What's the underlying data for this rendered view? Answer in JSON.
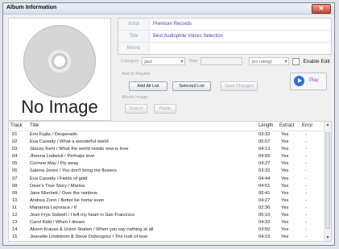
{
  "window": {
    "title": "Album Information",
    "close_glyph": "✕"
  },
  "art": {
    "placeholder_text": "No Image",
    "icon": "cd-disc-icon"
  },
  "meta": [
    {
      "label": "Artist",
      "value": "Premium Records"
    },
    {
      "label": "Title",
      "value": "Best Audiophile Voices Selection"
    },
    {
      "label": "Memo",
      "value": ""
    }
  ],
  "controls": {
    "category_label": "Category",
    "category_value": "jazz",
    "year_label": "Year",
    "year_value": "",
    "rating_value": "(no rating)",
    "enable_edit_label": "Enable Edit",
    "enable_edit_checked": false
  },
  "playlist": {
    "section_label": "Add to Playlist",
    "add_all_label": "Add All List",
    "selected_label": "Selected List",
    "save_changes_label": "Save Changes"
  },
  "album_image": {
    "section_label": "Album Image",
    "search_label": "Search",
    "paste_label": "Paste"
  },
  "play": {
    "label": "Play",
    "icon": "play-icon"
  },
  "tracks": {
    "headers": {
      "track": "Track",
      "title": "Title",
      "length": "Length",
      "extract": "Extract",
      "error": "Error"
    },
    "rows": [
      {
        "track": "01",
        "title": "Emi Fujita / Desperado",
        "length": "03:32",
        "extract": "Yes",
        "error": "-"
      },
      {
        "track": "02",
        "title": "Eva Cassidy / What a wonderful world",
        "length": "05:07",
        "extract": "Yes",
        "error": "-"
      },
      {
        "track": "03",
        "title": "Stacey Kent / What the world needs now is love",
        "length": "04:12",
        "extract": "Yes",
        "error": "-"
      },
      {
        "track": "04",
        "title": "Jheena Lodwick / Perhaps love",
        "length": "04:55",
        "extract": "Yes",
        "error": "-"
      },
      {
        "track": "05",
        "title": "Corinne May / Fly away",
        "length": "04:27",
        "extract": "Yes",
        "error": "-"
      },
      {
        "track": "06",
        "title": "Salena Jones / You don't bring me flowers",
        "length": "03:32",
        "extract": "Yes",
        "error": "-"
      },
      {
        "track": "07",
        "title": "Eva Cassidy / Fields of gold",
        "length": "04:44",
        "extract": "Yes",
        "error": "-"
      },
      {
        "track": "08",
        "title": "Dave's True Story / Marisa",
        "length": "04:01",
        "extract": "Yes",
        "error": "-"
      },
      {
        "track": "09",
        "title": "Jane Monheit / Over the rainbow",
        "length": "06:41",
        "extract": "Yes",
        "error": "-"
      },
      {
        "track": "10",
        "title": "Andrea Zonn / Better be home soon",
        "length": "04:27",
        "extract": "Yes",
        "error": "-"
      },
      {
        "track": "11",
        "title": "Marianna Leporace / If",
        "length": "02:36",
        "extract": "Yes",
        "error": "-"
      },
      {
        "track": "12",
        "title": "Jean Frye Sidwell / I left my heart in San Francisco",
        "length": "06:10",
        "extract": "Yes",
        "error": "-"
      },
      {
        "track": "13",
        "title": "Carol Kidd / When I dream",
        "length": "04:32",
        "extract": "Yes",
        "error": "-"
      },
      {
        "track": "14",
        "title": "Alison Krauss & Union Station / When you say nothing at all",
        "length": "03:50",
        "extract": "Yes",
        "error": "-"
      },
      {
        "track": "15",
        "title": "Jeanette Lindstrom & Steve Dobrogosz / The look of love",
        "length": "04:15",
        "extract": "Yes",
        "error": "-"
      }
    ]
  },
  "colors": {
    "meta_value": "#3c49b7",
    "play_label": "#c12fcf",
    "play_icon": "#2f6fd1"
  }
}
